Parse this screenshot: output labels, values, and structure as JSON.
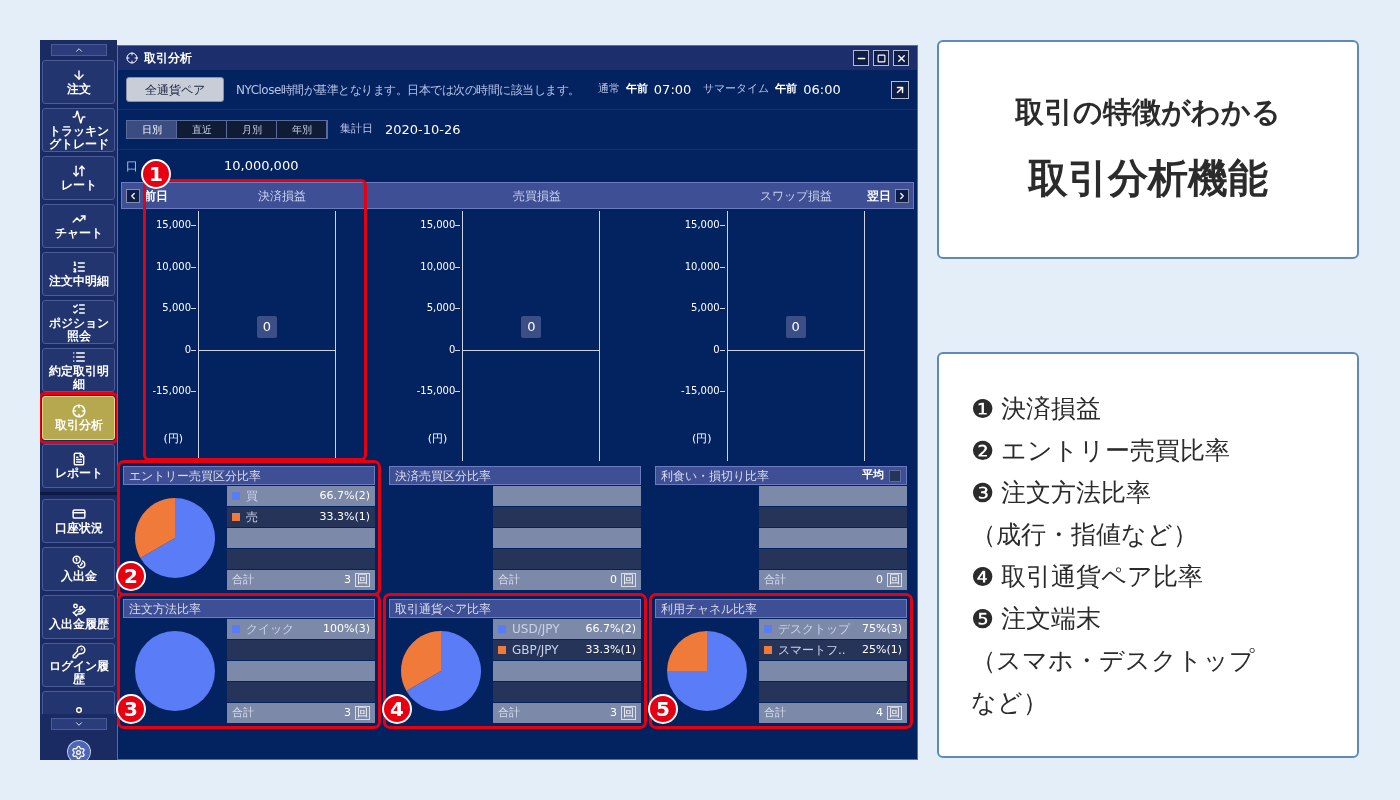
{
  "sidebar": {
    "items": [
      {
        "kind": "order",
        "label": "注文",
        "selected": false
      },
      {
        "kind": "tracking",
        "label": "トラッキングトレード",
        "selected": false
      },
      {
        "kind": "rate",
        "label": "レート",
        "selected": false
      },
      {
        "kind": "chart",
        "label": "チャート",
        "selected": false
      },
      {
        "kind": "orders",
        "label": "注文中明細",
        "selected": false
      },
      {
        "kind": "position",
        "label": "ポジション照会",
        "selected": false
      },
      {
        "kind": "executions",
        "label": "約定取引明細",
        "selected": false
      },
      {
        "kind": "analysis",
        "label": "取引分析",
        "selected": true
      },
      {
        "kind": "report",
        "label": "レポート",
        "selected": false
      },
      {
        "kind": "account",
        "label": "口座状況",
        "selected": false
      },
      {
        "kind": "deposit",
        "label": "入出金",
        "selected": false
      },
      {
        "kind": "deposit_history",
        "label": "入出金履歴",
        "selected": false
      },
      {
        "kind": "login",
        "label": "ログイン履歴",
        "selected": false
      },
      {
        "kind": "customer",
        "selected": false
      }
    ]
  },
  "window": {
    "title": "取引分析",
    "toolbar": {
      "pair_button": "全通貨ペア",
      "note": "NYClose時間が基準となります。日本では次の時間に該当します。",
      "normal_label": "通常",
      "normal_ampm": "午前",
      "normal_time": "07:00",
      "summer_label": "サマータイム",
      "summer_ampm": "午前",
      "summer_time": "06:00"
    },
    "tabs": [
      {
        "label": "日別",
        "selected": true
      },
      {
        "label": "直近",
        "selected": false
      },
      {
        "label": "月別",
        "selected": false
      },
      {
        "label": "年別",
        "selected": false
      }
    ],
    "date_label": "集計日",
    "date": "2020-10-26",
    "account_label": "口",
    "account_value": "10,000,000",
    "chart_header": {
      "prev": "前日",
      "next": "翌日"
    },
    "charts": [
      {
        "title": "決済損益",
        "y_labels": [
          "15,000",
          "10,000",
          "5,000",
          "0",
          "-15,000"
        ],
        "unit": "(円)",
        "value": "0",
        "marker": "1"
      },
      {
        "title": "売買損益",
        "y_labels": [
          "15,000",
          "10,000",
          "5,000",
          "0",
          "-15,000"
        ],
        "unit": "(円)",
        "value": "0"
      },
      {
        "title": "スワップ損益",
        "y_labels": [
          "15,000",
          "10,000",
          "5,000",
          "0",
          "-15,000"
        ],
        "unit": "(円)",
        "value": "0"
      }
    ],
    "panels": [
      {
        "title": "エントリー売買区分比率",
        "marker": "2",
        "rows": [
          {
            "label": "買",
            "value": "66.7%(2)",
            "color": "#5b7cf7"
          },
          {
            "label": "売",
            "value": "33.3%(1)",
            "color": "#f07a3a"
          }
        ],
        "total_label": "合計",
        "total": "3",
        "unit": "回",
        "chart_data": {
          "type": "pie",
          "values": [
            66.7,
            33.3
          ]
        }
      },
      {
        "title": "決済売買区分比率",
        "total_label": "合計",
        "total": "0",
        "unit": "回"
      },
      {
        "title": "利食い・損切り比率",
        "average": {
          "label": "平均",
          "checked": false
        },
        "total_label": "合計",
        "total": "0",
        "unit": "回"
      },
      {
        "title": "注文方法比率",
        "marker": "3",
        "rows": [
          {
            "label": "クイック",
            "value": "100%(3)",
            "color": "#5b7cf7"
          }
        ],
        "total_label": "合計",
        "total": "3",
        "unit": "回",
        "chart_data": {
          "type": "pie",
          "values": [
            100
          ]
        }
      },
      {
        "title": "取引通貨ペア比率",
        "marker": "4",
        "rows": [
          {
            "label": "USD/JPY",
            "value": "66.7%(2)",
            "color": "#5b7cf7"
          },
          {
            "label": "GBP/JPY",
            "value": "33.3%(1)",
            "color": "#f07a3a"
          }
        ],
        "total_label": "合計",
        "total": "3",
        "unit": "回",
        "chart_data": {
          "type": "pie",
          "values": [
            66.7,
            33.3
          ]
        }
      },
      {
        "title": "利用チャネル比率",
        "marker": "5",
        "rows": [
          {
            "label": "デスクトップ",
            "value": "75%(3)",
            "color": "#5b7cf7"
          },
          {
            "label": "スマートフ..",
            "value": "25%(1)",
            "color": "#f07a3a"
          }
        ],
        "total_label": "合計",
        "total": "4",
        "unit": "回",
        "chart_data": {
          "type": "pie",
          "values": [
            75,
            25
          ]
        }
      }
    ]
  },
  "headline": {
    "lines": [
      "取引の特徴がわかる",
      "取引分析機能"
    ]
  },
  "legend": {
    "items": [
      {
        "mark": "❶",
        "text": "決済損益"
      },
      {
        "mark": "❷",
        "text": "エントリー売買比率"
      },
      {
        "mark": "❸",
        "text": "注文方法比率",
        "note": "（成行・指値など）"
      },
      {
        "mark": "❹",
        "text": "取引通貨ペア比率"
      },
      {
        "mark": "❺",
        "text": "注文端末",
        "note": "（スマホ・デスクトップなど）"
      }
    ]
  }
}
